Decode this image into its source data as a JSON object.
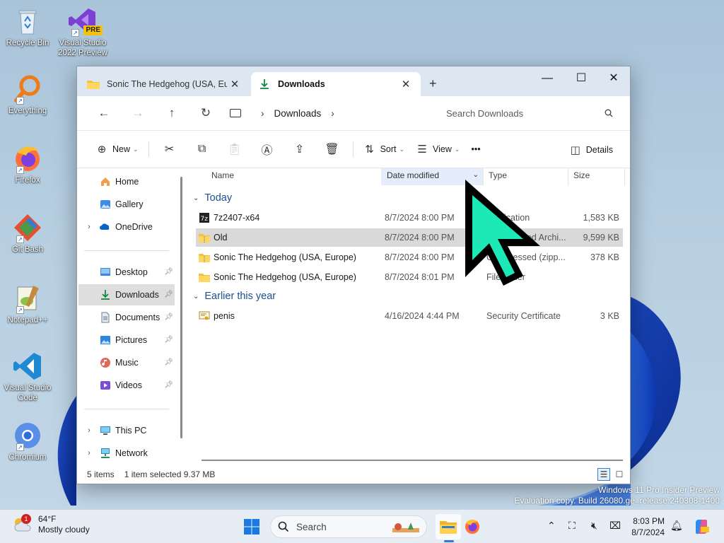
{
  "desktop": {
    "icons": [
      {
        "label": "Recycle Bin",
        "icon": "recycle-bin-icon"
      },
      {
        "label": "Visual Studio 2022 Preview",
        "icon": "visual-studio-icon",
        "badge": "PRE"
      },
      {
        "label": "Everything",
        "icon": "everything-search-icon"
      },
      {
        "label": "Firefox",
        "icon": "firefox-icon"
      },
      {
        "label": "Git Bash",
        "icon": "git-bash-icon"
      },
      {
        "label": "Notepad++",
        "icon": "notepad-plus-plus-icon"
      },
      {
        "label": "Visual Studio Code",
        "icon": "vscode-icon"
      },
      {
        "label": "Chromium",
        "icon": "chromium-icon"
      }
    ],
    "watermark": {
      "line1": "Windows 11 Pro Insider Preview",
      "line2": "Evaluation copy. Build 26080.ge_release.240308-1400"
    }
  },
  "window": {
    "tabs": [
      {
        "label": "Sonic The Hedgehog (USA, Europe)",
        "icon": "folder-icon",
        "active": false
      },
      {
        "label": "Downloads",
        "icon": "download-icon",
        "active": true
      }
    ],
    "new_tab": "+",
    "controls": {
      "minimize": "—",
      "maximize": "☐",
      "close": "✕"
    },
    "nav": {
      "back": "←",
      "forward": "→",
      "up": "↑",
      "refresh": "↻"
    },
    "address": {
      "segments": [
        "Downloads"
      ],
      "chevron": "›"
    },
    "search": {
      "placeholder": "Search Downloads"
    },
    "commands": {
      "new": "New",
      "sort": "Sort",
      "view": "View",
      "more": "•••",
      "details": "Details"
    },
    "sidebar": {
      "pinned_section": [
        {
          "label": "Home",
          "icon": "home-icon"
        },
        {
          "label": "Gallery",
          "icon": "gallery-icon"
        },
        {
          "label": "OneDrive",
          "icon": "onedrive-icon",
          "expandable": true
        }
      ],
      "quick_access": [
        {
          "label": "Desktop",
          "icon": "desktop-folder-icon",
          "pinned": true
        },
        {
          "label": "Downloads",
          "icon": "download-icon",
          "pinned": true,
          "selected": true
        },
        {
          "label": "Documents",
          "icon": "documents-icon",
          "pinned": true
        },
        {
          "label": "Pictures",
          "icon": "pictures-icon",
          "pinned": true
        },
        {
          "label": "Music",
          "icon": "music-icon",
          "pinned": true
        },
        {
          "label": "Videos",
          "icon": "videos-icon",
          "pinned": true
        }
      ],
      "devices": [
        {
          "label": "This PC",
          "icon": "this-pc-icon",
          "expandable": true
        },
        {
          "label": "Network",
          "icon": "network-icon",
          "expandable": true
        }
      ]
    },
    "columns": {
      "name": "Name",
      "date": "Date modified",
      "type": "Type",
      "size": "Size"
    },
    "groups": [
      {
        "label": "Today",
        "files": [
          {
            "name": "7z2407-x64",
            "date": "8/7/2024 8:00 PM",
            "type": "Application",
            "size": "1,583 KB",
            "icon": "7zip-app-icon"
          },
          {
            "name": "Old",
            "date": "8/7/2024 8:00 PM",
            "type": "Compressed Archi...",
            "size": "9,599 KB",
            "icon": "zip-folder-icon",
            "selected": true
          },
          {
            "name": "Sonic The Hedgehog (USA, Europe)",
            "date": "8/7/2024 8:00 PM",
            "type": "Compressed (zipp...",
            "size": "378 KB",
            "icon": "zip-folder-icon"
          },
          {
            "name": "Sonic The Hedgehog (USA, Europe)",
            "date": "8/7/2024 8:01 PM",
            "type": "File folder",
            "size": "",
            "icon": "folder-icon"
          }
        ]
      },
      {
        "label": "Earlier this year",
        "files": [
          {
            "name": "penis",
            "date": "4/16/2024 4:44 PM",
            "type": "Security Certificate",
            "size": "3 KB",
            "icon": "certificate-icon"
          }
        ]
      }
    ],
    "status": {
      "items": "5 items",
      "selection": "1 item selected  9.37 MB"
    }
  },
  "taskbar": {
    "weather": {
      "temp": "64°F",
      "condition": "Mostly cloudy",
      "badge": "1"
    },
    "search_label": "Search",
    "clock": {
      "time": "8:03 PM",
      "date": "8/7/2024"
    }
  },
  "colors": {
    "accent": "#0067c0",
    "selection": "#d9d9d9",
    "sorted_header": "#e3eefa",
    "cursor_fill": "#1de9b6",
    "group_text": "#1d4f91"
  }
}
